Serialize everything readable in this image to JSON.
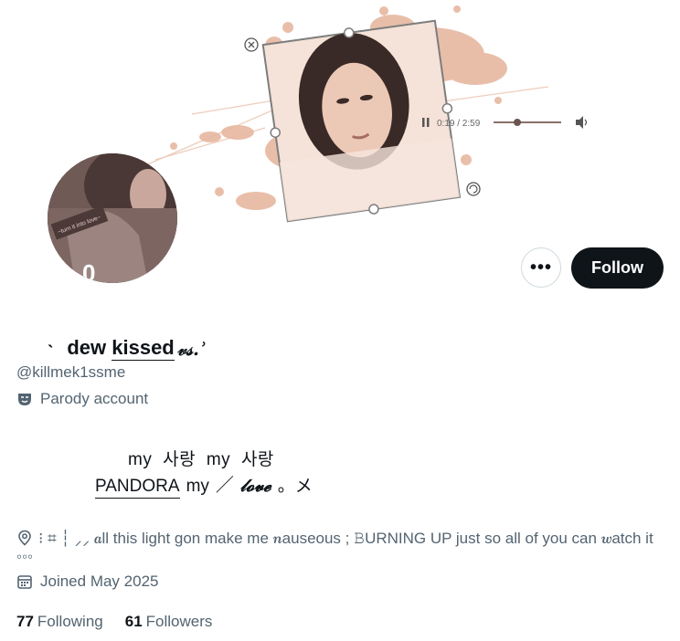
{
  "profile": {
    "name_prefix": "ˎ",
    "name_main": "dew",
    "name_underlined": "kissed",
    "name_suffix": "𝓋𝓈.ʾ",
    "handle": "@killmek1ssme",
    "parody_label": "Parody account",
    "bio_line1": "my  사랑  my  사랑",
    "bio_line2_a": "PANDORA",
    "bio_line2_b": "my",
    "bio_line2_c": "／",
    "bio_line2_d": "𝓁𝓸𝓿𝓮",
    "bio_line2_e": "。メ",
    "location": "⁝ ⌗ ┆ ⸝⸝ 𝒂ll this light gon make me 𝒏auseous ; 𝙱URNING UP just so all of you can 𝒘atch it ◦◦◦",
    "joined": "Joined May 2025"
  },
  "buttons": {
    "more": "•••",
    "follow": "Follow"
  },
  "stats": {
    "following_count": "77",
    "following_label": "Following",
    "followers_count": "61",
    "followers_label": "Followers"
  },
  "banner": {
    "player_time": "0:19 / 2:59"
  },
  "avatar": {
    "tag_text": "~turn it into love~"
  },
  "icons": {
    "more": "more-icon",
    "parody": "mask-icon",
    "location": "location-pin-icon",
    "calendar": "calendar-icon",
    "pause": "pause-icon",
    "volume": "volume-icon"
  },
  "colors": {
    "accent_follow_bg": "#0f1419",
    "muted_text": "#536471",
    "banner_peach": "#e7b8a0"
  }
}
